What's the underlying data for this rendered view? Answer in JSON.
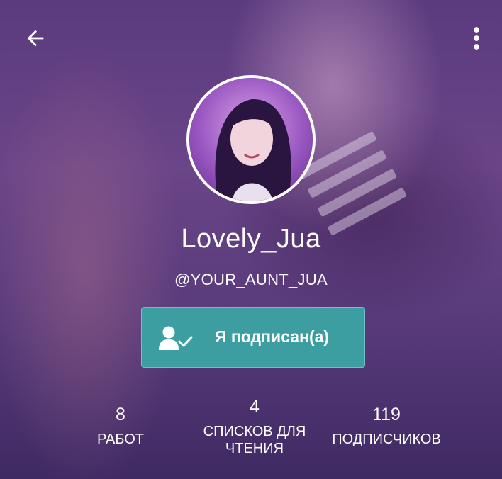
{
  "profile": {
    "display_name": "Lovely_Jua",
    "handle": "@YOUR_AUNT_JUA"
  },
  "follow_button": {
    "label": "Я подписан(а)",
    "icon": "user-check-icon"
  },
  "header": {
    "back_icon": "arrow-left-icon",
    "menu_icon": "more-vertical-icon"
  },
  "stats": [
    {
      "value": "8",
      "label": "РАБОТ"
    },
    {
      "value": "4",
      "label": "СПИСКОВ ДЛЯ ЧТЕНИЯ"
    },
    {
      "value": "119",
      "label": "ПОДПИСЧИКОВ"
    }
  ],
  "colors": {
    "background": "#5b3a7e",
    "button": "#3d9ea1",
    "text": "#ffffff"
  }
}
